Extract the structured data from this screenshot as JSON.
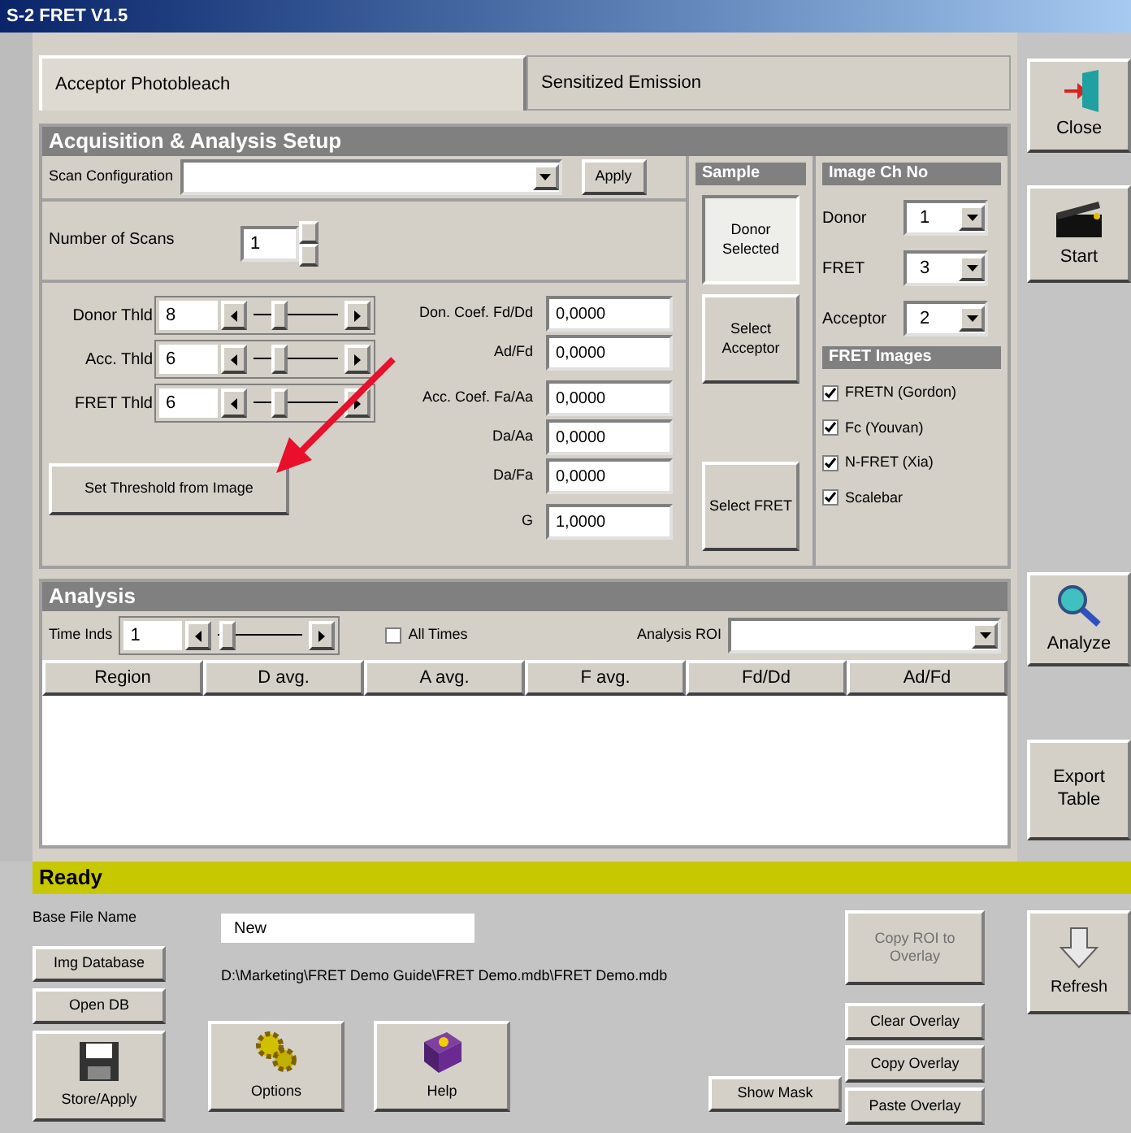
{
  "window": {
    "title": "S-2 FRET V1.5"
  },
  "tabs": [
    {
      "label": "Acceptor Photobleach",
      "selected": true
    },
    {
      "label": "Sensitized Emission",
      "selected": false
    }
  ],
  "setup": {
    "title": "Acquisition & Analysis Setup",
    "scan_label": "Scan Configuration",
    "apply": "Apply",
    "scans_label": "Number of Scans",
    "scans_value": "1",
    "thresholds": [
      {
        "label": "Donor Thld",
        "value": "8",
        "level": 0.3
      },
      {
        "label": "Acc. Thld",
        "value": "6",
        "level": 0.3
      },
      {
        "label": "FRET Thld",
        "value": "6",
        "level": 0.3
      }
    ],
    "set_threshold": "Set Threshold from Image",
    "coefficients": [
      {
        "label": "Don. Coef. Fd/Dd",
        "value": "0,0000"
      },
      {
        "label": "Ad/Fd",
        "value": "0,0000"
      },
      {
        "label": "Acc. Coef. Fa/Aa",
        "value": "0,0000"
      },
      {
        "label": "Da/Aa",
        "value": "0,0000"
      },
      {
        "label": "Da/Fa",
        "value": "0,0000"
      },
      {
        "label": "G",
        "value": "1,0000"
      }
    ]
  },
  "sample": {
    "title": "Sample",
    "buttons": [
      {
        "label": "Donor Selected",
        "selected": true
      },
      {
        "label": "Select Acceptor",
        "selected": false
      },
      {
        "label": "Select FRET",
        "selected": false
      }
    ]
  },
  "image_ch": {
    "title": "Image Ch No",
    "channels": [
      {
        "label": "Donor",
        "value": "1"
      },
      {
        "label": "FRET",
        "value": "3"
      },
      {
        "label": "Acceptor",
        "value": "2"
      }
    ]
  },
  "fret_images": {
    "title": "FRET Images",
    "items": [
      {
        "label": "FRETN (Gordon)",
        "checked": true
      },
      {
        "label": "Fc (Youvan)",
        "checked": true
      },
      {
        "label": "N-FRET (Xia)",
        "checked": true
      },
      {
        "label": "Scalebar",
        "checked": true
      }
    ]
  },
  "analysis": {
    "title": "Analysis",
    "time_label": "Time Inds",
    "time_value": "1",
    "level": 0.1,
    "all_times": {
      "label": "All Times",
      "checked": false
    },
    "roi_label": "Analysis ROI",
    "columns": [
      "Region",
      "D avg.",
      "A avg.",
      "F avg.",
      "Fd/Dd",
      "Ad/Fd"
    ]
  },
  "side_buttons": [
    {
      "label": "Close",
      "kind": "door"
    },
    {
      "label": "Start",
      "kind": "clapper"
    },
    {
      "label": "Analyze",
      "kind": "magnifier"
    },
    {
      "label": "Export Table",
      "kind": "plain"
    }
  ],
  "status_bar": "Ready",
  "bottom": {
    "base_file_label": "Base File Name",
    "base_file_value": "New",
    "path": "D:\\Marketing\\FRET Demo Guide\\FRET Demo.mdb\\FRET Demo.mdb",
    "db_buttons": [
      "Img Database",
      "Open DB"
    ],
    "icon_buttons": [
      {
        "label": "Store/Apply",
        "kind": "floppy"
      },
      {
        "label": "Options",
        "kind": "gears"
      },
      {
        "label": "Help",
        "kind": "book"
      }
    ],
    "show_mask": "Show Mask",
    "overlay_buttons": [
      {
        "label": "Copy ROI to Overlay",
        "disabled": true
      },
      {
        "label": "Clear Overlay",
        "disabled": false
      },
      {
        "label": "Copy Overlay",
        "disabled": false
      },
      {
        "label": "Paste Overlay",
        "disabled": false
      }
    ],
    "refresh": "Refresh"
  }
}
